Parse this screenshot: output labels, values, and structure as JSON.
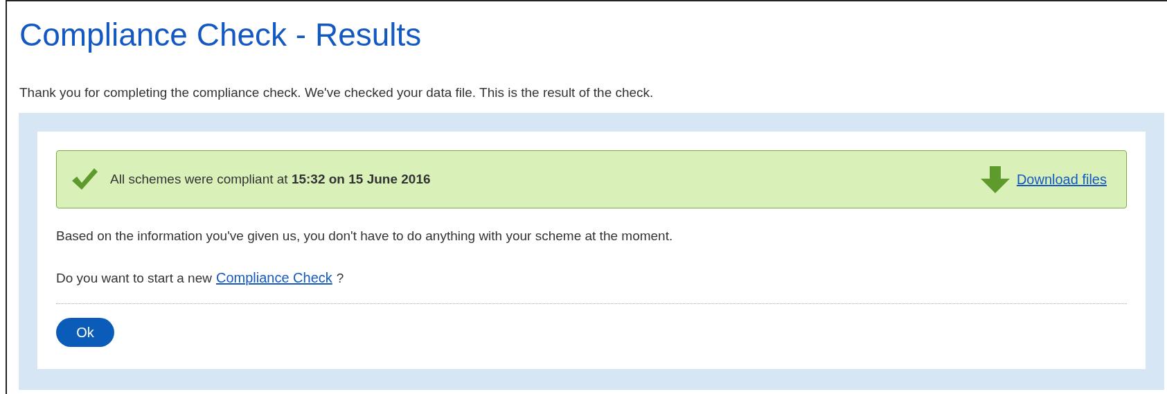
{
  "page": {
    "title": "Compliance Check - Results",
    "intro": "Thank you for completing the compliance check. We've checked your data file. This is the result of the check."
  },
  "result_banner": {
    "kind": "success",
    "message": "All schemes were compliant at **15:32 on 15 June 2016**",
    "download_link": "Download files"
  },
  "info": "Based on the information you've given us, you don't have to do anything with your scheme at the moment.",
  "restart": {
    "prefix": "Do you want to start a new",
    "link": "Compliance Check",
    "suffix": "?"
  },
  "buttons": [
    "Ok"
  ]
}
